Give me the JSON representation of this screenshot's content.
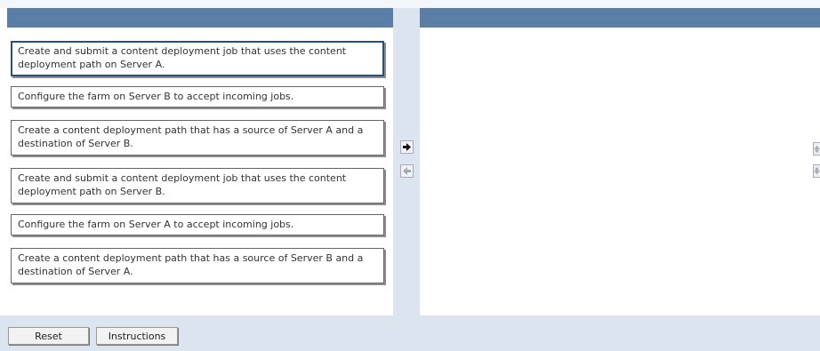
{
  "left_items": [
    "Create and submit a content deployment job that uses the content deployment path on Server A.",
    "Configure the farm on Server B to accept incoming jobs.",
    "Create a content deployment path that has a source of Server A and a destination of Server B.",
    "Create and submit a content deployment job that uses the content deployment path on Server B.",
    "Configure the farm on Server A to accept incoming jobs.",
    "Create a content deployment path that has a source of Server B and a destination of Server A."
  ],
  "buttons": {
    "reset": "Reset",
    "instructions": "Instructions"
  },
  "icons": {
    "move_right": "arrow-right-icon",
    "move_left": "arrow-left-icon",
    "move_up": "arrow-up-icon",
    "move_down": "arrow-down-icon"
  },
  "colors": {
    "header": "#5a7ea6",
    "side": "#dbe4ef",
    "selected_border": "#2a4f7a"
  }
}
